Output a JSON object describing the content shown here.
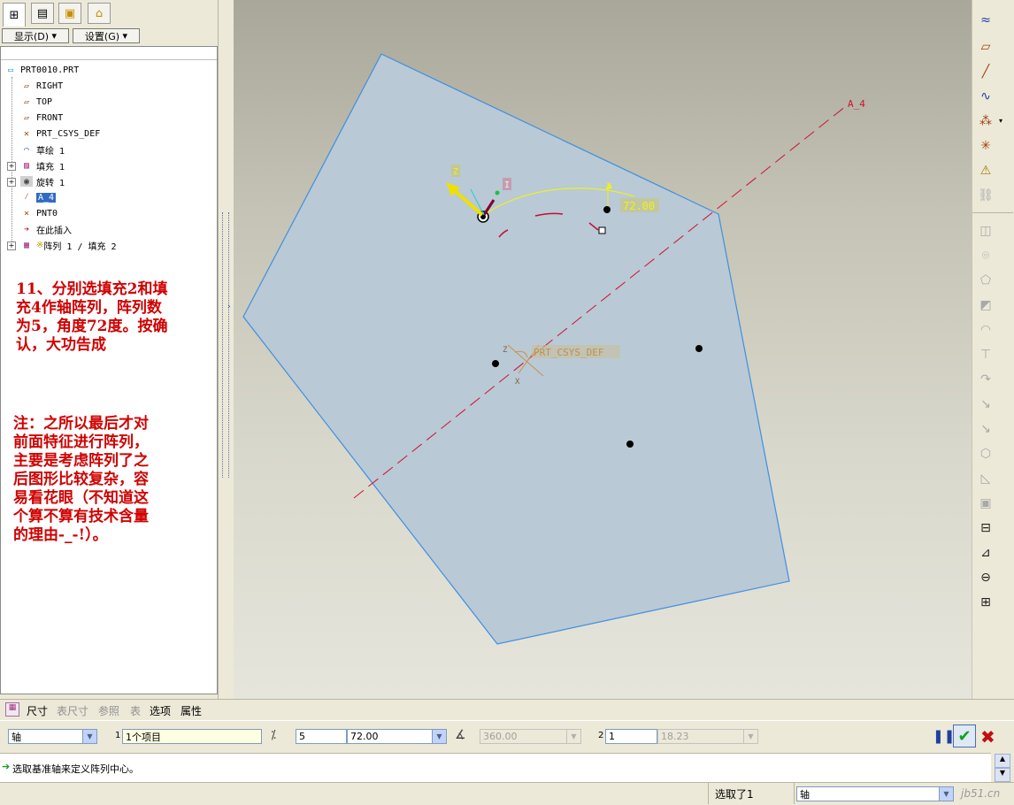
{
  "left_panel": {
    "tabs": [
      "model-tree-tab",
      "layers-tab",
      "folder-tab",
      "favorites-tab"
    ],
    "menu": {
      "display": "显示(D)",
      "settings": "设置(G)"
    },
    "tree": [
      {
        "label": "PRT0010.PRT",
        "icon": "part-icon"
      },
      {
        "label": "RIGHT",
        "icon": "datum-plane-icon"
      },
      {
        "label": "TOP",
        "icon": "datum-plane-icon"
      },
      {
        "label": "FRONT",
        "icon": "datum-plane-icon"
      },
      {
        "label": "PRT_CSYS_DEF",
        "icon": "csys-icon"
      },
      {
        "label": "草绘 1",
        "icon": "sketch-icon"
      },
      {
        "label": "填充 1",
        "icon": "fill-icon"
      },
      {
        "label": "旋转 1",
        "icon": "rotate-icon"
      },
      {
        "label": "A_4",
        "icon": "datum-axis-icon"
      },
      {
        "label": "PNT0",
        "icon": "datum-point-icon"
      },
      {
        "label": "在此插入",
        "icon": "insert-here-icon"
      },
      {
        "label": "阵列 1 / 填充 2",
        "icon": "pattern-icon"
      }
    ],
    "note1": "11、分别选填充2和填\n充4作轴阵列，阵列数\n为5，角度72度。按确\n认，大功告成",
    "note2": "注：之所以最后才对\n前面特征进行阵列，\n主要是考虑阵列了之\n后图形比较复杂，容\n易看花眼（不知道这\n个算不算有技术含量\n的理由-_-!）。"
  },
  "viewport": {
    "axis_label": "A_4",
    "csys_label": "PRT_CSYS_DEF",
    "angle_value": "72.00",
    "z_label": "Z",
    "x_label": "X",
    "i_label": "I",
    "colors": {
      "fill": "#b8c8d6",
      "edge": "#3f8fde",
      "axis": "#d01030",
      "dim": "#e0e020"
    }
  },
  "dashboard": {
    "tabs": [
      "尺寸",
      "表尺寸",
      "参照",
      "表",
      "选项",
      "属性"
    ],
    "pattern_type": "轴",
    "dir1_number": "1",
    "dir1_items": "1个项目",
    "member_count": "5",
    "angle": "72.00",
    "angle_range": "360.00",
    "dir2_number": "2",
    "dir2_count": "1",
    "dir2_spacing": "18.23"
  },
  "message": "选取基准轴来定义阵列中心。",
  "status": {
    "selected": "选取了1",
    "filter": "轴",
    "watermark": "jb51.cn"
  }
}
